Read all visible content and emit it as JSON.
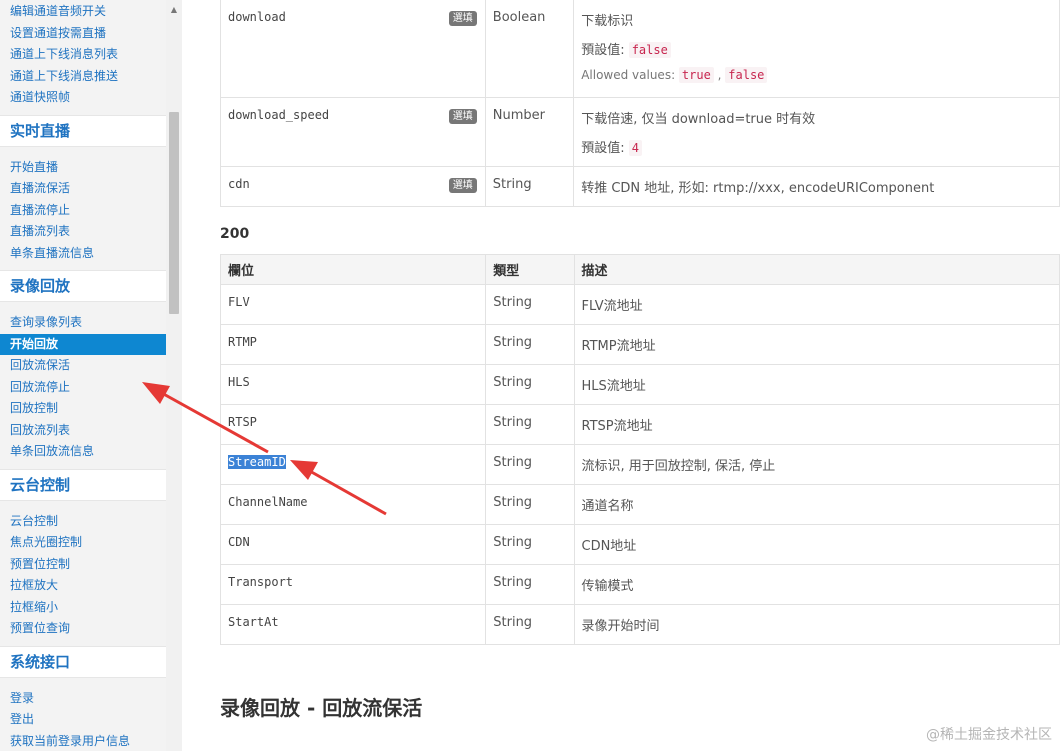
{
  "sidebar": {
    "top_items": [
      "编辑通道音频开关",
      "设置通道按需直播",
      "通道上下线消息列表",
      "通道上下线消息推送",
      "通道快照帧"
    ],
    "sections": [
      {
        "title": "实时直播",
        "items": [
          "开始直播",
          "直播流保活",
          "直播流停止",
          "直播流列表",
          "单条直播流信息"
        ]
      },
      {
        "title": "录像回放",
        "items": [
          "查询录像列表",
          "开始回放",
          "回放流保活",
          "回放流停止",
          "回放控制",
          "回放流列表",
          "单条回放流信息"
        ],
        "active_index": 1
      },
      {
        "title": "云台控制",
        "items": [
          "云台控制",
          "焦点光圈控制",
          "预置位控制",
          "拉框放大",
          "拉框缩小",
          "预置位查询"
        ]
      },
      {
        "title": "系统接口",
        "items": [
          "登录",
          "登出",
          "获取当前登录用户信息"
        ]
      }
    ]
  },
  "params": [
    {
      "field": "download",
      "badge": "選填",
      "type": "Boolean",
      "desc": "下载标识",
      "default_label": "預設值: ",
      "default": "false",
      "allowed_label": "Allowed values: ",
      "allowed": [
        "true",
        "false"
      ]
    },
    {
      "field": "download_speed",
      "badge": "選填",
      "type": "Number",
      "desc": "下载倍速, 仅当 download=true 时有效",
      "default_label": "預設值: ",
      "default": "4"
    },
    {
      "field": "cdn",
      "badge": "選填",
      "type": "String",
      "desc": "转推 CDN 地址, 形如: rtmp://xxx, encodeURIComponent"
    }
  ],
  "response": {
    "code": "200",
    "headers": [
      "欄位",
      "類型",
      "描述"
    ],
    "rows": [
      {
        "field": "FLV",
        "type": "String",
        "desc": "FLV流地址"
      },
      {
        "field": "RTMP",
        "type": "String",
        "desc": "RTMP流地址"
      },
      {
        "field": "HLS",
        "type": "String",
        "desc": "HLS流地址"
      },
      {
        "field": "RTSP",
        "type": "String",
        "desc": "RTSP流地址"
      },
      {
        "field": "StreamID",
        "type": "String",
        "desc": "流标识, 用于回放控制, 保活, 停止"
      },
      {
        "field": "ChannelName",
        "type": "String",
        "desc": "通道名称"
      },
      {
        "field": "CDN",
        "type": "String",
        "desc": "CDN地址"
      },
      {
        "field": "Transport",
        "type": "String",
        "desc": "传输模式"
      },
      {
        "field": "StartAt",
        "type": "String",
        "desc": "录像开始时间"
      }
    ]
  },
  "section_title": "录像回放 - 回放流保活",
  "watermark": "@稀土掘金技术社区",
  "colors": {
    "accent": "#0e87d1",
    "link": "#1f73c1",
    "arrow": "#e53935",
    "highlight": "#3b82d6"
  }
}
